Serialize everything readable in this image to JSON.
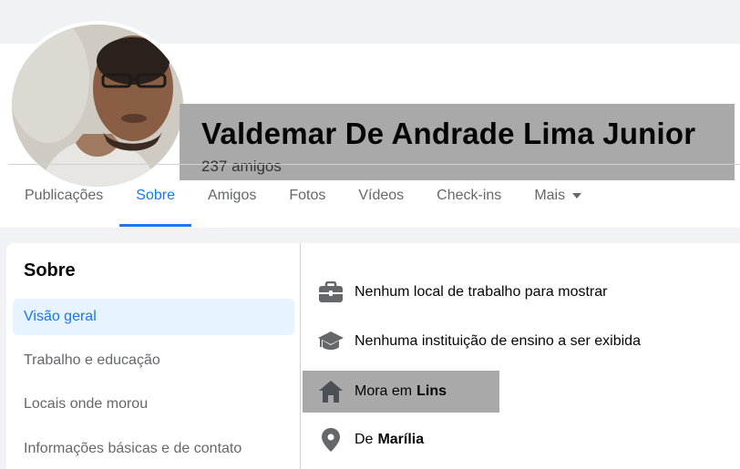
{
  "profile": {
    "name": "Valdemar De Andrade Lima Junior",
    "friends": "237 amigos"
  },
  "tabs": [
    {
      "label": "Publicações",
      "active": false
    },
    {
      "label": "Sobre",
      "active": true
    },
    {
      "label": "Amigos",
      "active": false
    },
    {
      "label": "Fotos",
      "active": false
    },
    {
      "label": "Vídeos",
      "active": false
    },
    {
      "label": "Check-ins",
      "active": false
    },
    {
      "label": "Mais",
      "active": false
    }
  ],
  "about": {
    "title": "Sobre",
    "menu": [
      {
        "label": "Visão geral",
        "active": true
      },
      {
        "label": "Trabalho e educação",
        "active": false
      },
      {
        "label": "Locais onde morou",
        "active": false
      },
      {
        "label": "Informações básicas e de contato",
        "active": false
      }
    ],
    "details": [
      {
        "icon": "briefcase-icon",
        "text": "Nenhum local de trabalho para mostrar",
        "bold": ""
      },
      {
        "icon": "graduation-cap-icon",
        "text": "Nenhuma instituição de ensino a ser exibida",
        "bold": ""
      },
      {
        "icon": "home-icon",
        "text": "Mora em",
        "bold": "Lins"
      },
      {
        "icon": "location-pin-icon",
        "text": "De",
        "bold": "Marília"
      }
    ]
  },
  "colors": {
    "accent": "#1877f2",
    "redaction": "#a9a9a9",
    "secondary_text": "#65676b"
  }
}
